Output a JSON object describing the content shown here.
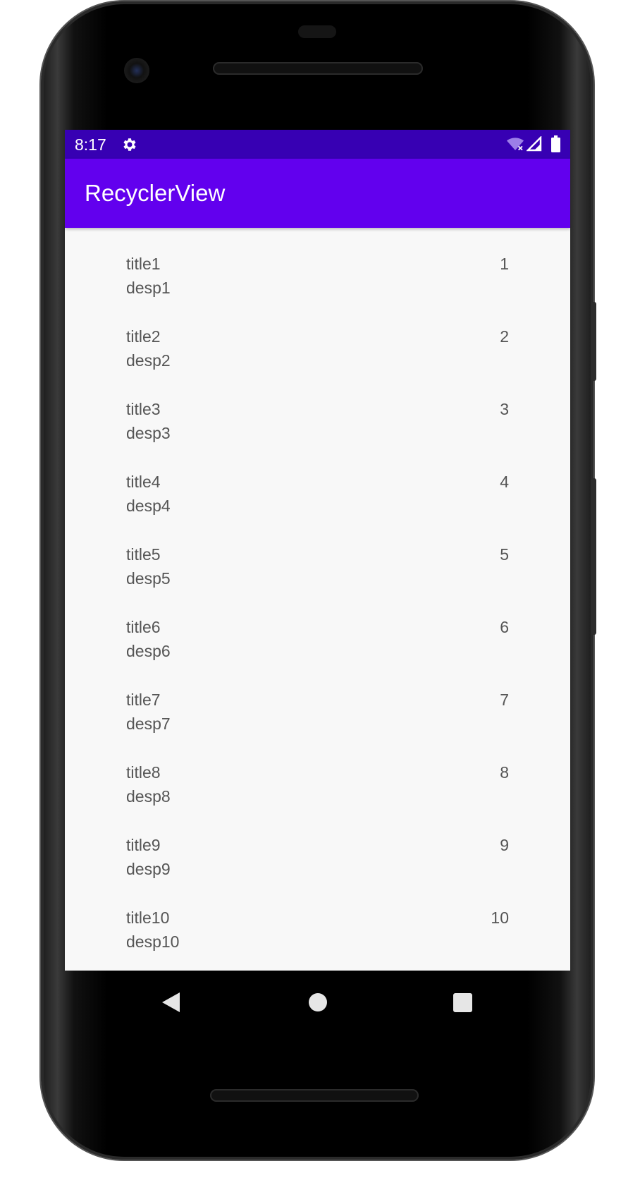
{
  "status_bar": {
    "time": "8:17",
    "icons": [
      "gear-icon",
      "wifi-off-icon",
      "signal-icon",
      "battery-icon"
    ]
  },
  "app_bar": {
    "title": "RecyclerView"
  },
  "list": {
    "items": [
      {
        "title": "title1",
        "desp": "desp1",
        "count": "1"
      },
      {
        "title": "title2",
        "desp": "desp2",
        "count": "2"
      },
      {
        "title": "title3",
        "desp": "desp3",
        "count": "3"
      },
      {
        "title": "title4",
        "desp": "desp4",
        "count": "4"
      },
      {
        "title": "title5",
        "desp": "desp5",
        "count": "5"
      },
      {
        "title": "title6",
        "desp": "desp6",
        "count": "6"
      },
      {
        "title": "title7",
        "desp": "desp7",
        "count": "7"
      },
      {
        "title": "title8",
        "desp": "desp8",
        "count": "8"
      },
      {
        "title": "title9",
        "desp": "desp9",
        "count": "9"
      },
      {
        "title": "title10",
        "desp": "desp10",
        "count": "10"
      }
    ]
  },
  "nav_bar": {
    "icons": [
      "back-icon",
      "home-icon",
      "recents-icon"
    ]
  },
  "colors": {
    "status_bar": "#3700b3",
    "app_bar": "#6200ee",
    "screen_background": "#f8f8f8",
    "item_text": "#555555"
  }
}
